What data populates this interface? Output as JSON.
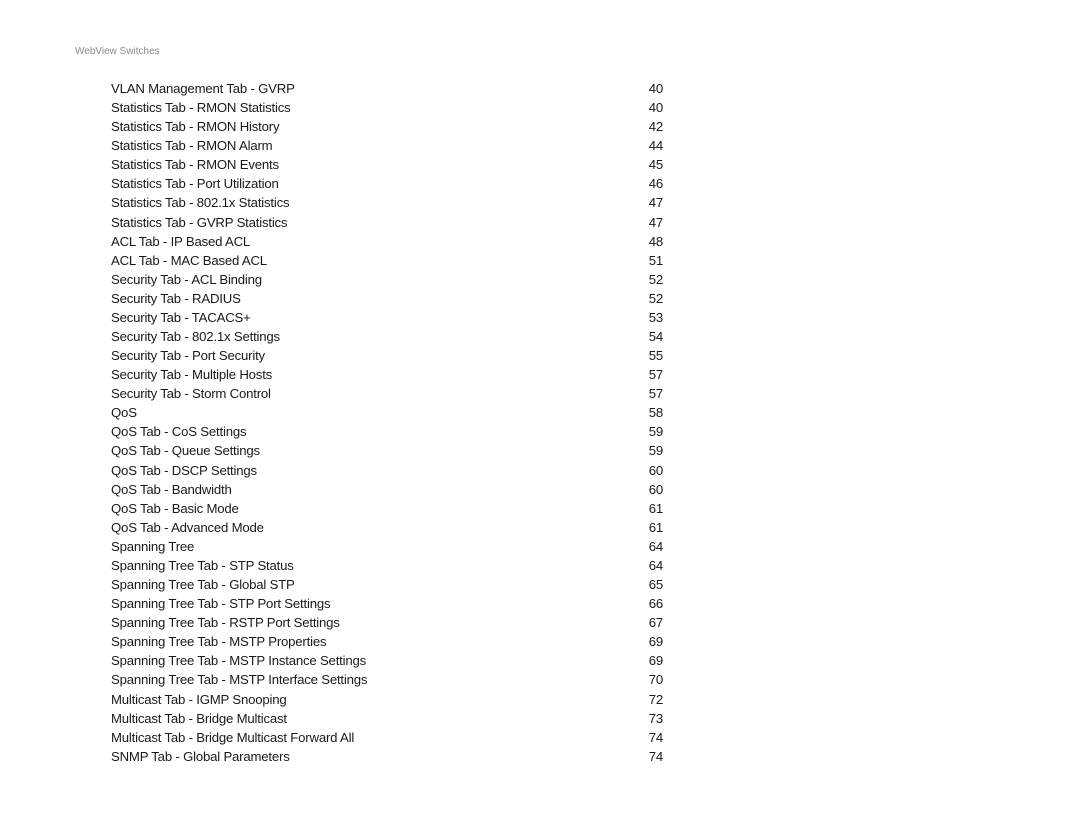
{
  "header": {
    "running_title": "WebView Switches"
  },
  "toc": {
    "entries": [
      {
        "title": "VLAN Management Tab - GVRP",
        "page": "40"
      },
      {
        "title": "Statistics Tab - RMON Statistics",
        "page": "40"
      },
      {
        "title": "Statistics Tab - RMON History",
        "page": "42"
      },
      {
        "title": "Statistics Tab - RMON Alarm",
        "page": "44"
      },
      {
        "title": "Statistics Tab - RMON Events",
        "page": "45"
      },
      {
        "title": "Statistics Tab - Port Utilization",
        "page": "46"
      },
      {
        "title": "Statistics Tab - 802.1x Statistics",
        "page": "47"
      },
      {
        "title": "Statistics Tab - GVRP Statistics",
        "page": "47"
      },
      {
        "title": "ACL Tab - IP Based ACL",
        "page": "48"
      },
      {
        "title": "ACL Tab - MAC Based ACL",
        "page": "51"
      },
      {
        "title": "Security Tab - ACL Binding",
        "page": "52"
      },
      {
        "title": "Security Tab - RADIUS",
        "page": "52"
      },
      {
        "title": "Security Tab - TACACS+",
        "page": "53"
      },
      {
        "title": "Security Tab - 802.1x Settings",
        "page": "54"
      },
      {
        "title": "Security Tab - Port Security",
        "page": "55"
      },
      {
        "title": "Security Tab - Multiple Hosts",
        "page": "57"
      },
      {
        "title": "Security Tab - Storm Control",
        "page": "57"
      },
      {
        "title": "QoS",
        "page": "58"
      },
      {
        "title": "QoS Tab - CoS Settings",
        "page": "59"
      },
      {
        "title": "QoS Tab - Queue Settings",
        "page": "59"
      },
      {
        "title": "QoS Tab - DSCP Settings",
        "page": "60"
      },
      {
        "title": "QoS Tab - Bandwidth",
        "page": "60"
      },
      {
        "title": "QoS Tab - Basic Mode",
        "page": "61"
      },
      {
        "title": "QoS Tab - Advanced Mode",
        "page": "61"
      },
      {
        "title": "Spanning Tree",
        "page": "64"
      },
      {
        "title": "Spanning Tree Tab - STP Status",
        "page": "64"
      },
      {
        "title": "Spanning Tree Tab - Global STP",
        "page": "65"
      },
      {
        "title": "Spanning Tree Tab - STP Port Settings",
        "page": "66"
      },
      {
        "title": "Spanning Tree Tab - RSTP Port Settings",
        "page": "67"
      },
      {
        "title": "Spanning Tree Tab - MSTP Properties",
        "page": "69"
      },
      {
        "title": "Spanning Tree Tab - MSTP Instance Settings",
        "page": "69"
      },
      {
        "title": "Spanning Tree Tab - MSTP Interface Settings",
        "page": "70"
      },
      {
        "title": "Multicast Tab - IGMP Snooping",
        "page": "72"
      },
      {
        "title": "Multicast Tab - Bridge Multicast",
        "page": "73"
      },
      {
        "title": "Multicast Tab - Bridge Multicast Forward All",
        "page": "74"
      },
      {
        "title": "SNMP Tab - Global Parameters",
        "page": "74"
      }
    ]
  }
}
